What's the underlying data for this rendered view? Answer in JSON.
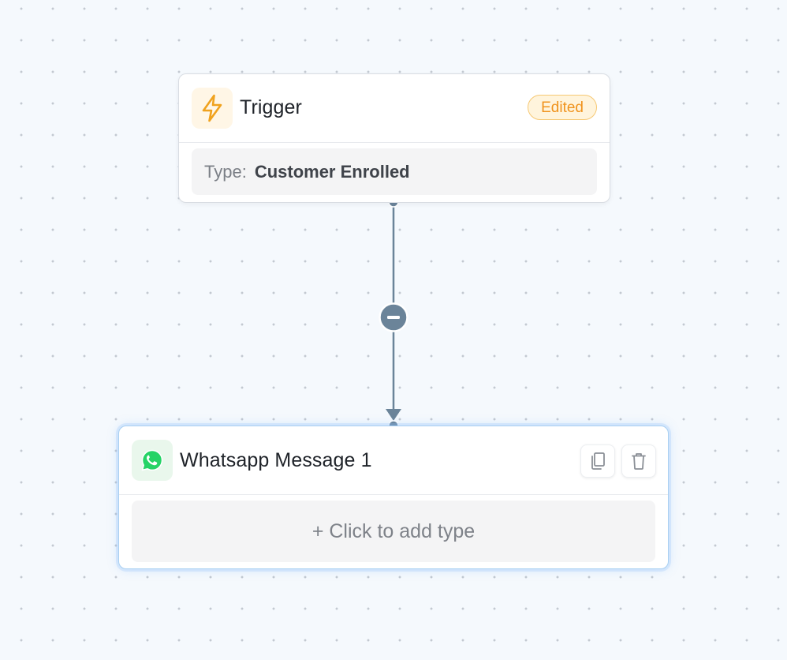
{
  "trigger_node": {
    "title": "Trigger",
    "badge": "Edited",
    "type_label": "Type:",
    "type_value": "Customer Enrolled",
    "icon": "lightning-bolt-icon"
  },
  "action_node": {
    "title": "Whatsapp Message 1",
    "add_type_label": "+ Click to add type",
    "icon": "whatsapp-icon",
    "actions": [
      "copy-icon",
      "trash-icon"
    ]
  },
  "edge": {
    "control_icon": "minus-icon"
  },
  "colors": {
    "canvas_bg": "#f5f9fd",
    "edge": "#6b8499",
    "badge_text": "#f0931d",
    "badge_border": "#f6c873",
    "selected_border": "#a9d0f2",
    "whatsapp_green": "#25d366"
  }
}
